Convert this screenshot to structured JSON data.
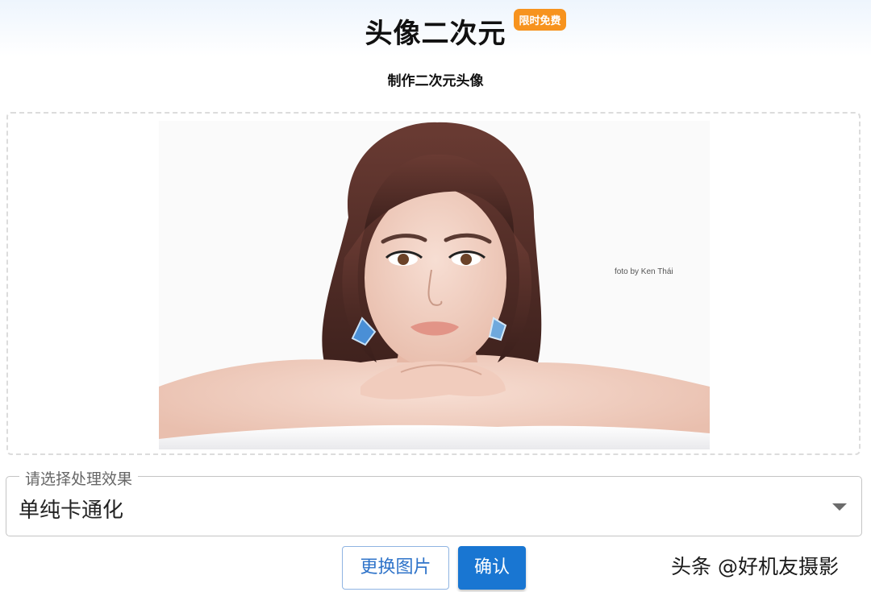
{
  "header": {
    "title": "头像二次元",
    "badge": "限时免费"
  },
  "subtitle": "制作二次元头像",
  "preview": {
    "photo_credit": "foto by  Ken Thái"
  },
  "effect_select": {
    "label": "请选择处理效果",
    "value": "单纯卡通化"
  },
  "actions": {
    "change_image": "更换图片",
    "confirm": "确认"
  },
  "source_watermark": "头条 @好机友摄影",
  "colors": {
    "accent": "#1976d2",
    "badge": "#f7931e"
  }
}
